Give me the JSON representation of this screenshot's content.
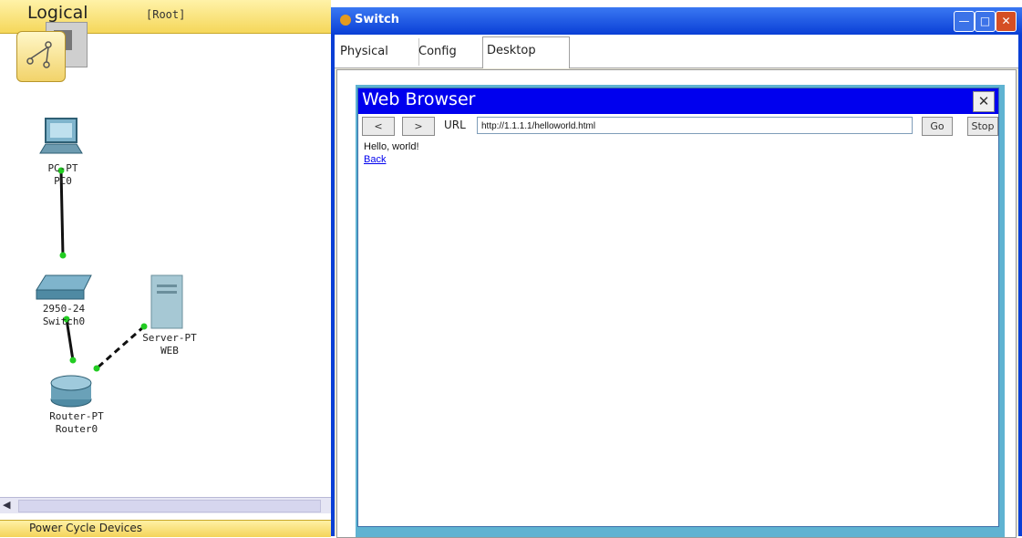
{
  "workspace": {
    "mode_label": "Logical",
    "root_label": "[Root]",
    "status_label": "Power Cycle Devices",
    "devices": [
      {
        "type": "PC-PT",
        "name": "PC0"
      },
      {
        "type": "2950-24",
        "name": "Switch0"
      },
      {
        "type": "Server-PT",
        "name": "WEB"
      },
      {
        "type": "Router-PT",
        "name": "Router0"
      }
    ],
    "link_color": "#22cc22"
  },
  "window": {
    "title": "Switch",
    "tabs": [
      {
        "label": "Physical"
      },
      {
        "label": "Config"
      },
      {
        "label": "Desktop",
        "active": true
      }
    ]
  },
  "browser": {
    "title": "Web Browser",
    "close_glyph": "✕",
    "back_glyph": "<",
    "forward_glyph": ">",
    "url_label": "URL",
    "url_value": "http://1.1.1.1/helloworld.html",
    "go_label": "Go",
    "stop_label": "Stop",
    "page_text": "Hello, world!",
    "page_link": "Back"
  }
}
